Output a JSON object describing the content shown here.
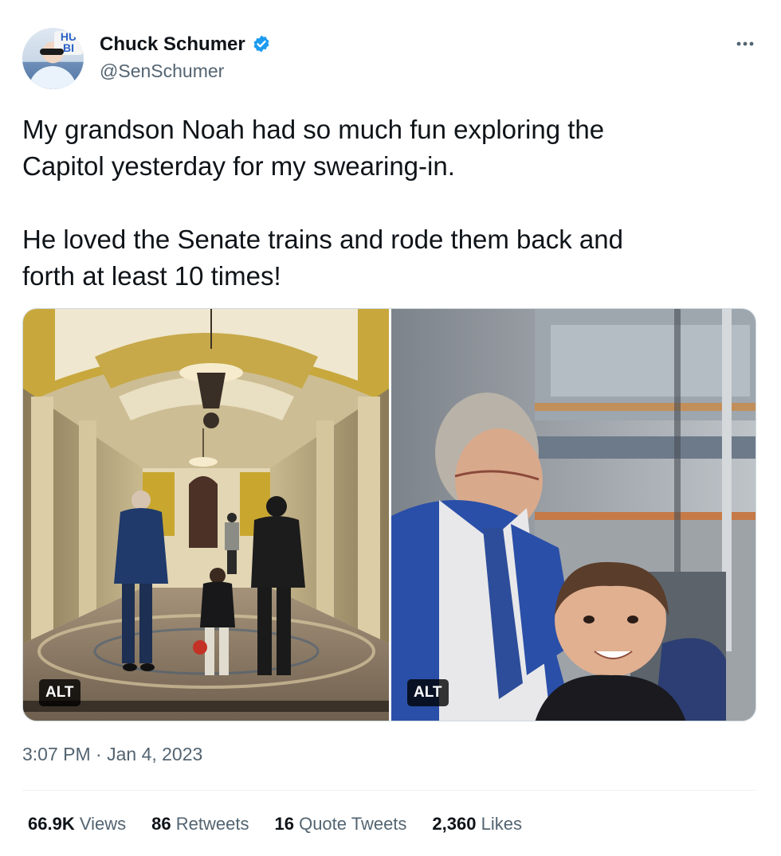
{
  "author": {
    "name": "Chuck Schumer",
    "handle": "@SenSchumer",
    "avatar_sign_text": "HU\nBI",
    "verified_color": "#1d9bf0"
  },
  "tweet": {
    "text": "My grandson Noah had so much fun exploring the\nCapitol yesterday for my swearing-in.\n\nHe loved the Senate trains and rode them back and\nforth at least 10 times!",
    "timestamp": "3:07 PM · Jan 4, 2023"
  },
  "media": [
    {
      "alt_badge": "ALT"
    },
    {
      "alt_badge": "ALT"
    }
  ],
  "stats": {
    "views_count": "66.9K",
    "views_label": "Views",
    "retweets_count": "86",
    "retweets_label": "Retweets",
    "quotes_count": "16",
    "quotes_label": "Quote Tweets",
    "likes_count": "2,360",
    "likes_label": "Likes"
  },
  "icons": {
    "verified": "verified-badge-icon",
    "more": "more-options-icon"
  }
}
